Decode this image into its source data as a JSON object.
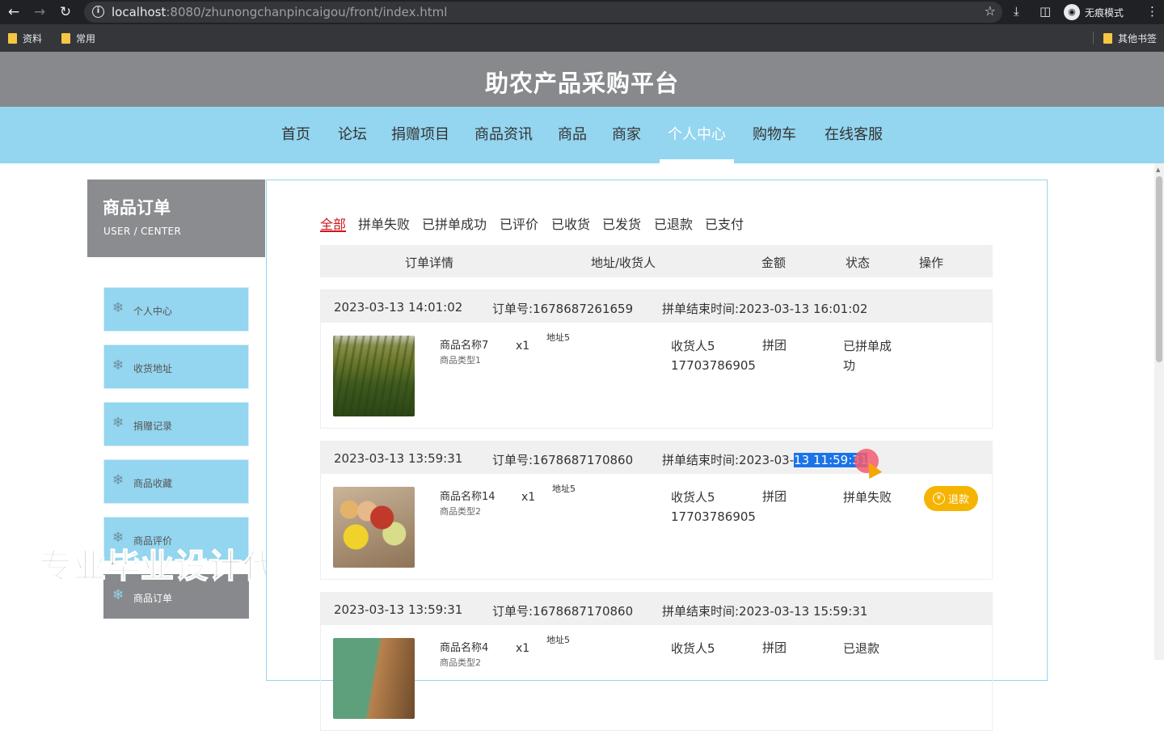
{
  "browser": {
    "url_host": "localhost",
    "url_path": ":8080/zhunongchanpincaigou/front/index.html",
    "incognito_label": "无痕模式",
    "bookmarks": [
      "资料",
      "常用"
    ],
    "other_bookmarks": "其他书签"
  },
  "site": {
    "title": "助农产品采购平台",
    "nav": [
      "首页",
      "论坛",
      "捐赠项目",
      "商品资讯",
      "商品",
      "商家",
      "个人中心",
      "购物车",
      "在线客服"
    ],
    "active_nav": "个人中心"
  },
  "sidebar": {
    "title": "商品订单",
    "subtitle": "USER / CENTER",
    "items": [
      "个人中心",
      "收货地址",
      "捐赠记录",
      "商品收藏",
      "商品评价",
      "商品订单"
    ],
    "active_item": "商品订单"
  },
  "watermark": "专业毕业设计代做",
  "filters": {
    "tabs": [
      "全部",
      "拼单失败",
      "已拼单成功",
      "已评价",
      "已收货",
      "已发货",
      "已退款",
      "已支付"
    ],
    "active": "全部"
  },
  "table_headers": [
    "订单详情",
    "地址/收货人",
    "金额",
    "状态",
    "操作"
  ],
  "orders": [
    {
      "date": "2023-03-13 14:01:02",
      "order_no": "订单号:1678687261659",
      "end_time": "拼单结束时间:2023-03-13 16:01:02",
      "product_name": "商品名称7",
      "product_type": "商品类型1",
      "qty": "x1",
      "address": "地址5",
      "receiver": "收货人5",
      "phone": "17703786905",
      "amount": "拼团",
      "status": "已拼单成功"
    },
    {
      "date": "2023-03-13 13:59:31",
      "order_no": "订单号:1678687170860",
      "end_time_prefix": "拼单结束时间:2023-03-",
      "end_time_selected": "13 11:59:31",
      "product_name": "商品名称14",
      "product_type": "商品类型2",
      "qty": "x1",
      "address": "地址5",
      "receiver": "收货人5",
      "phone": "17703786905",
      "amount": "拼团",
      "status": "拼单失败",
      "action": "退款",
      "action_color": "#f5b400"
    },
    {
      "date": "2023-03-13 13:59:31",
      "order_no": "订单号:1678687170860",
      "end_time": "拼单结束时间:2023-03-13 15:59:31",
      "product_name": "商品名称4",
      "product_type": "商品类型2",
      "qty": "x1",
      "address": "地址5",
      "receiver": "收货人5",
      "amount": "拼团",
      "status": "已退款"
    }
  ],
  "colors": {
    "header_gray": "#87898c",
    "nav_blue": "#94d5ef",
    "active_red": "#d0161e",
    "refund_yellow": "#f5b400"
  }
}
